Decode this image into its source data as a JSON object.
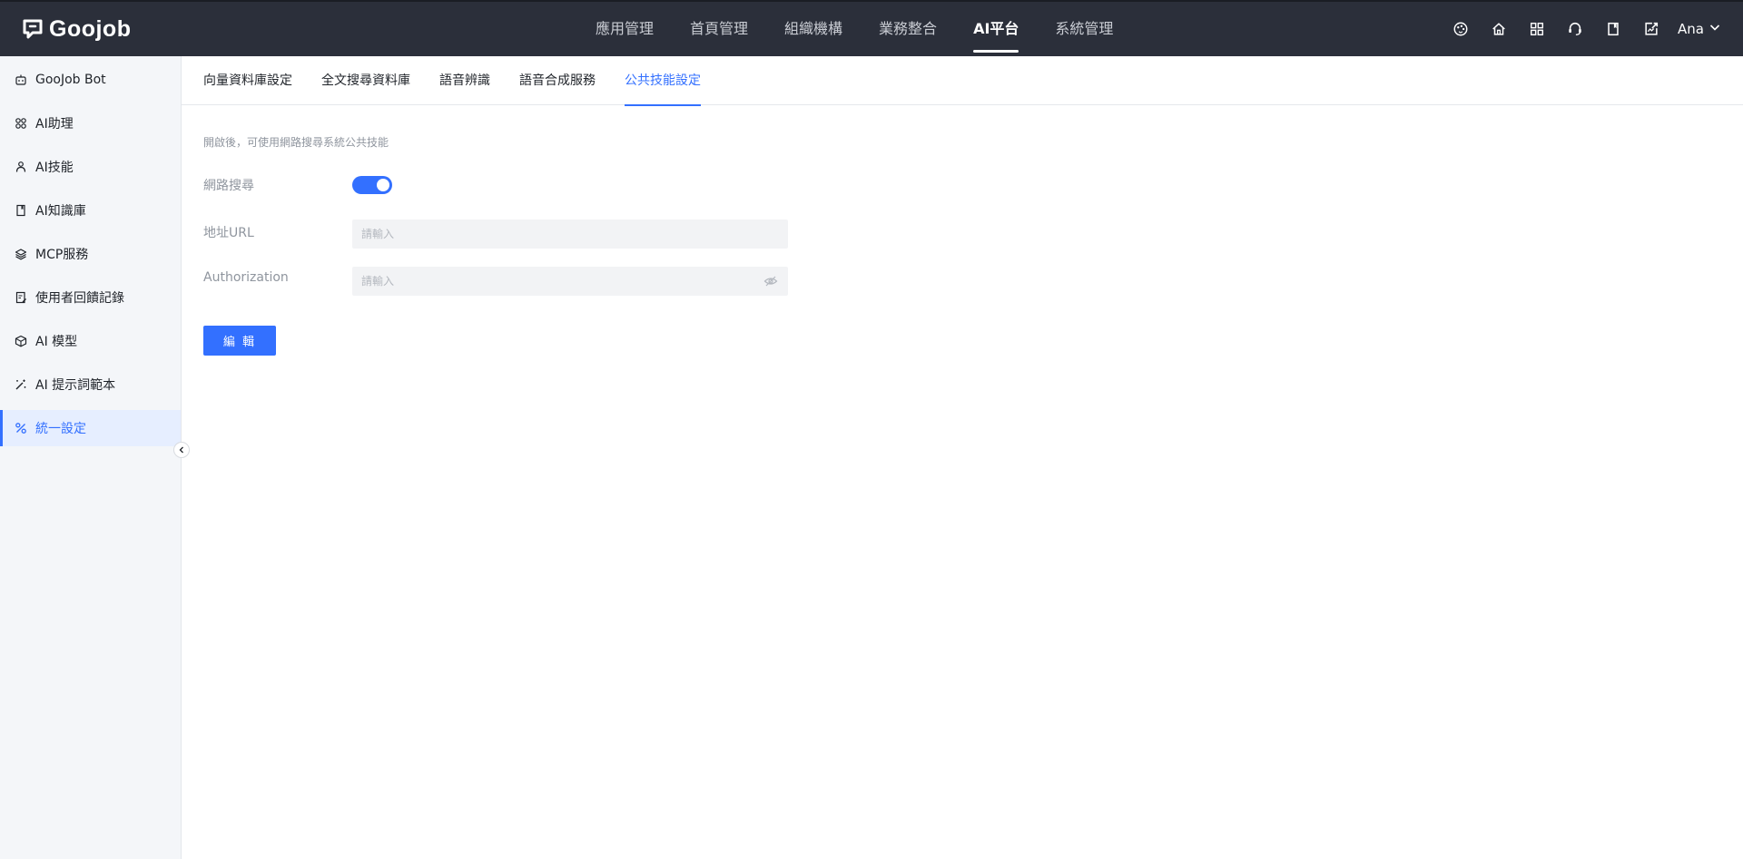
{
  "app": {
    "logo_text": "Goojob",
    "logo_icon": "chat-bubble-icon"
  },
  "topnav": {
    "items": [
      {
        "label": "應用管理",
        "active": false
      },
      {
        "label": "首頁管理",
        "active": false
      },
      {
        "label": "組織機構",
        "active": false
      },
      {
        "label": "業務整合",
        "active": false
      },
      {
        "label": "AI平台",
        "active": true
      },
      {
        "label": "系統管理",
        "active": false
      }
    ],
    "icons": [
      "palette-icon",
      "home-icon",
      "apps-grid-icon",
      "support-headset-icon",
      "book-icon",
      "export-icon"
    ],
    "user_name": "Ana"
  },
  "sidebar": {
    "items": [
      {
        "label": "GooJob Bot",
        "icon": "bot-icon",
        "active": false
      },
      {
        "label": "AI助理",
        "icon": "grid-icon",
        "active": false
      },
      {
        "label": "AI技能",
        "icon": "skill-icon",
        "active": false
      },
      {
        "label": "AI知識庫",
        "icon": "book-icon",
        "active": false
      },
      {
        "label": "MCP服務",
        "icon": "layers-icon",
        "active": false
      },
      {
        "label": "使用者回饋記錄",
        "icon": "feedback-icon",
        "active": false
      },
      {
        "label": "AI 模型",
        "icon": "cube-icon",
        "active": false
      },
      {
        "label": "AI 提示詞範本",
        "icon": "magic-wand-icon",
        "active": false
      },
      {
        "label": "統一設定",
        "icon": "settings-percent-icon",
        "active": true
      }
    ]
  },
  "tabs": {
    "items": [
      {
        "label": "向量資料庫設定",
        "active": false
      },
      {
        "label": "全文搜尋資料庫",
        "active": false
      },
      {
        "label": "語音辨識",
        "active": false
      },
      {
        "label": "語音合成服務",
        "active": false
      },
      {
        "label": "公共技能設定",
        "active": true
      }
    ]
  },
  "form": {
    "hint": "開啟後，可使用網路搜尋系統公共技能",
    "web_search_label": "網路搜尋",
    "web_search_enabled": true,
    "url_label": "地址URL",
    "url_placeholder": "請輸入",
    "url_value": "",
    "auth_label": "Authorization",
    "auth_placeholder": "請輸入",
    "auth_value": "",
    "edit_button": "編 輯"
  },
  "colors": {
    "topbar_bg": "#2b2f3a",
    "accent": "#3370ff",
    "sidebar_bg": "#f4f6f9",
    "sidebar_active_bg": "#e6eeff"
  }
}
